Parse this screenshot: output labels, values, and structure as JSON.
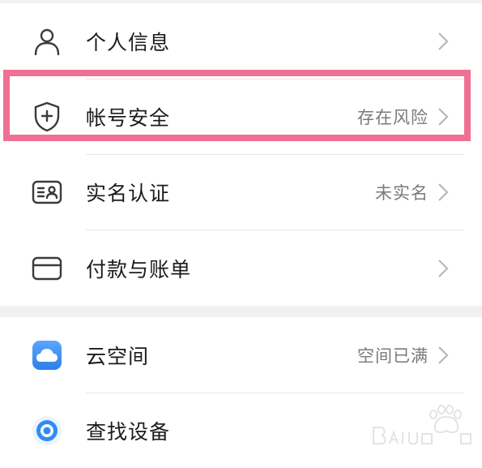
{
  "menu": {
    "items": [
      {
        "label": "个人信息",
        "value": "",
        "icon": "person-icon"
      },
      {
        "label": "帐号安全",
        "value": "存在风险",
        "icon": "shield-plus-icon"
      },
      {
        "label": "实名认证",
        "value": "未实名",
        "icon": "id-card-icon"
      },
      {
        "label": "付款与账单",
        "value": "",
        "icon": "card-icon"
      },
      {
        "label": "云空间",
        "value": "空间已满",
        "icon": "cloud-app-icon"
      },
      {
        "label": "查找设备",
        "value": "",
        "icon": "find-device-app-icon"
      }
    ]
  },
  "colors": {
    "highlight": "#ef6f95",
    "cloud_blue": "#3c8cf3"
  },
  "watermark": {
    "icon": "baidu-watermark-icon"
  }
}
